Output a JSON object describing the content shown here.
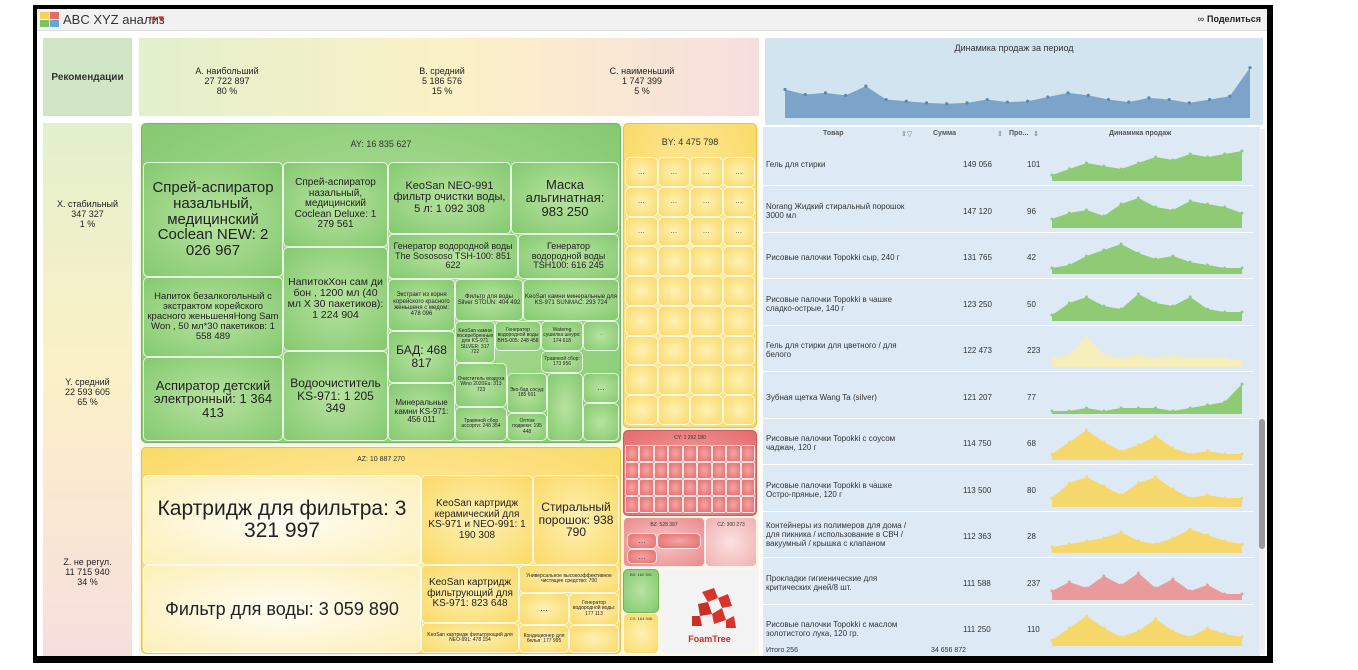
{
  "app": {
    "title": "ABC XYZ анализ",
    "share_label": "Поделиться",
    "bookmark_icon": "bookmark-icon"
  },
  "recommend": {
    "label": "Рекомендации"
  },
  "abc": [
    {
      "label": "A. наибольший",
      "value": "27 722 897",
      "pct": "80 %"
    },
    {
      "label": "B. средний",
      "value": "5 186 576",
      "pct": "15 %"
    },
    {
      "label": "C. наименьший",
      "value": "1 747 399",
      "pct": "5 %"
    }
  ],
  "xyz": [
    {
      "label": "X. стабильный",
      "value": "347 327",
      "pct": "1 %"
    },
    {
      "label": "Y. средний",
      "value": "22 593 605",
      "pct": "65 %"
    },
    {
      "label": "Z. не регул.",
      "value": "11 715 940",
      "pct": "34 %"
    }
  ],
  "dynamics": {
    "title": "Динамика продаж за период",
    "series": [
      34,
      28,
      30,
      27,
      38,
      22,
      20,
      18,
      17,
      18,
      22,
      19,
      20,
      25,
      30,
      27,
      22,
      19,
      24,
      22,
      18,
      22,
      26,
      60
    ]
  },
  "treemap": {
    "ay": {
      "title": "AY: 16 835 627",
      "tiles": [
        "Спрей-аспиратор назальный, медицинский Coclean NEW: 2 026 967",
        "Спрей-аспиратор назальный, медицинский Coclean Deluxe: 1 279 561",
        "KeoSan NEO-991 фильтр очистки воды, 5 л: 1 092 308",
        "Маска альгинатная: 983 250",
        "Генератор водородной воды The Sosososo TSH-100: 851 622",
        "Генератор водородной воды TSH100: 616 245",
        "Напиток безалкогольный с экстрактом корейского красного женьшеняHong Sam Won , 50 мл*30 пакетиков: 1 558 489",
        "НапитокХон сам ди бон , 1200 мл (40 мл X 30 пакетиков): 1 224 904",
        "Экстракт из корня корейского красного женьшеня с медом: 478 096",
        "Фильтр для воды Silver STOUN: 404 492",
        "KeoSan камни минеральные для KS-971 SUNMAC: 293 724",
        "KeoSan камни посеребренные для KS-971 SILVER: 317 722",
        "Генератор водородной воды BHS-005: 248 458",
        "Waterng сушилка шнуро: 174 618",
        "Аспиратор детский электронный: 1 364 413",
        "БАД: 468 817",
        "Водоочиститель KS-971: 1 205 349",
        "Травяной сбор: 173 956",
        "Очиститель воздуха Wino 2020Eu: 313 723",
        "Минеральные камни KS-971: 456 011",
        "Травяной сбор ассорти: 248 354",
        "Эко-бад сосуд: 185 661",
        "Оптом подвеки: 195 448"
      ]
    },
    "by": {
      "title": "BY: 4 475 798"
    },
    "az": {
      "title": "AZ: 10 887 270",
      "tiles": [
        "Картридж для фильтра: 3 321 997",
        "Фильтр для воды: 3 059 890",
        "KeoSan картридж керамический для KS-971 и NEO-991: 1 190 308",
        "Стиральный порошок: 938 790",
        "KeoSan картридж фильтрующий для KS-971: 823 648",
        "KeoSan картридж фильтрующий для NEO-991: 478 154",
        "Универсальное высокоэффективное чистящее средство: 700",
        "Кондиционер для белья: 177 995",
        "Генератор водородной воды: 177 113"
      ]
    },
    "cy": {
      "title": "CY: 1 292 180"
    },
    "bz": {
      "title": "BZ: 528 397"
    },
    "cz": {
      "title": "CZ: 300 273"
    },
    "bx": {
      "title": "BX: 162 391"
    },
    "cx": {
      "title": "CX: 164 946"
    },
    "foamtree": "FoamTree",
    "ellipsis": "..."
  },
  "table": {
    "headers": {
      "product": "Товар",
      "sum": "Сумма",
      "pct": "Про...",
      "dyn": "Динамика продаж"
    },
    "rows": [
      {
        "name": "Гель для стирки",
        "sum": "149 056",
        "qty": "101",
        "color": "#8fcb74",
        "spark": [
          2,
          4,
          6,
          5,
          4,
          6,
          8,
          7,
          9,
          8,
          9,
          10
        ]
      },
      {
        "name": "Norang Жидкий стиральный порошок 3000 мл",
        "sum": "147 120",
        "qty": "96",
        "color": "#8fcb74",
        "spark": [
          3,
          5,
          6,
          4,
          8,
          10,
          7,
          6,
          9,
          8,
          7,
          5
        ]
      },
      {
        "name": "Рисовые палочки Topokki сыр, 240 г",
        "sum": "131 765",
        "qty": "42",
        "color": "#8fcb74",
        "spark": [
          2,
          3,
          6,
          8,
          10,
          7,
          5,
          6,
          4,
          3,
          2,
          2
        ]
      },
      {
        "name": "Рисовые палочки Topokki в чашке сладко-острые, 140 г",
        "sum": "123 250",
        "qty": "50",
        "color": "#8fcb74",
        "spark": [
          2,
          6,
          8,
          5,
          4,
          9,
          6,
          5,
          8,
          4,
          3,
          3
        ]
      },
      {
        "name": "Гель для стирки для цветного / для белого",
        "sum": "122 473",
        "qty": "223",
        "color": "#f5eebb",
        "spark": [
          3,
          4,
          10,
          4,
          3,
          4,
          3,
          4,
          3,
          3,
          3,
          2
        ]
      },
      {
        "name": "Зубная щетка Wang Ta (silver)",
        "sum": "121 207",
        "qty": "77",
        "color": "#8fcb74",
        "spark": [
          1,
          1,
          2,
          1,
          2,
          2,
          2,
          1,
          2,
          3,
          4,
          10
        ]
      },
      {
        "name": "Рисовые палочки Topokki с соусом чаджан, 120 г",
        "sum": "114 750",
        "qty": "68",
        "color": "#f6d76b",
        "spark": [
          2,
          6,
          10,
          6,
          3,
          5,
          8,
          4,
          2,
          3,
          2,
          2
        ]
      },
      {
        "name": "Рисовые палочки Topokki в чашке Остро-пряные, 120 г",
        "sum": "113 500",
        "qty": "80",
        "color": "#f6d76b",
        "spark": [
          3,
          8,
          10,
          7,
          4,
          8,
          10,
          6,
          3,
          4,
          3,
          3
        ]
      },
      {
        "name": "Контейнеры из полимеров для дома / для пикника / использование в СВЧ / вакуумный / крышка с клапаном",
        "sum": "112 363",
        "qty": "28",
        "color": "#f6d76b",
        "spark": [
          2,
          3,
          4,
          5,
          7,
          4,
          3,
          5,
          8,
          6,
          4,
          3
        ]
      },
      {
        "name": "Прокладки гигиенические для критических дней/8 шт.",
        "sum": "111 588",
        "qty": "237",
        "color": "#e99a9a",
        "spark": [
          3,
          6,
          4,
          8,
          5,
          9,
          4,
          7,
          3,
          5,
          2,
          2
        ]
      },
      {
        "name": "Рисовые палочки Topokki с маслом золотистого лука, 120 гр.",
        "sum": "111 250",
        "qty": "110",
        "color": "#f6d76b",
        "spark": [
          2,
          6,
          10,
          6,
          3,
          5,
          9,
          5,
          3,
          6,
          4,
          3
        ]
      }
    ],
    "footer": {
      "label": "Итого 256",
      "total": "34 656 872"
    }
  }
}
